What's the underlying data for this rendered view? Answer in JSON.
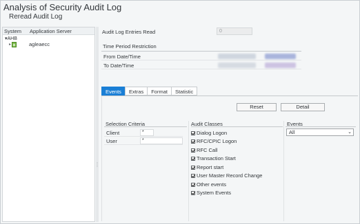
{
  "window": {
    "title": "Analysis of Security Audit Log"
  },
  "toolbar": {
    "reread_label": "Reread Audit Log"
  },
  "tree": {
    "col_system": "System",
    "col_server": "Application Server",
    "root_label": "AHB",
    "child_label": "agleaecc"
  },
  "header_fields": {
    "entries_read_label": "Audit Log Entries Read",
    "entries_read_value": "0"
  },
  "time_period": {
    "title": "Time Period Restriction",
    "from_label": "From Date/Time",
    "to_label": "To Date/Time"
  },
  "tabs": [
    {
      "label": "Events",
      "active": true
    },
    {
      "label": "Extras",
      "active": false
    },
    {
      "label": "Format",
      "active": false
    },
    {
      "label": "Statistic",
      "active": false
    }
  ],
  "buttons": {
    "reset": "Reset",
    "detail": "Detail"
  },
  "selection_criteria": {
    "header": "Selection Criteria",
    "rows": [
      {
        "label": "Client",
        "value": "*"
      },
      {
        "label": "User",
        "value": "*"
      }
    ]
  },
  "audit_classes": {
    "header": "Audit Classes",
    "items": [
      {
        "label": "Dialog Logon",
        "checked": true
      },
      {
        "label": "RFC/CPIC Logon",
        "checked": true
      },
      {
        "label": "RFC Call",
        "checked": true
      },
      {
        "label": "Transaction Start",
        "checked": true
      },
      {
        "label": "Report start",
        "checked": true
      },
      {
        "label": "User Master Record Change",
        "checked": true
      },
      {
        "label": "Other events",
        "checked": true
      },
      {
        "label": "System Events",
        "checked": true
      }
    ]
  },
  "events": {
    "header": "Events",
    "selected": "All",
    "arrow_icon": "chevron-down-icon"
  },
  "colors": {
    "accent": "#1a7fd6",
    "redacted_date": "#c9d3e0",
    "redacted_highlight": "#b8a9d6"
  }
}
